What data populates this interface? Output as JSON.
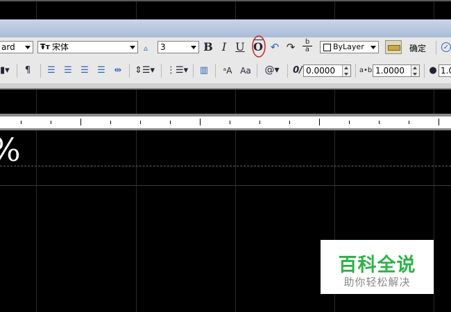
{
  "toolbar1": {
    "style_value": "ard",
    "font_icon": "Ŧт",
    "font_value": "宋体",
    "height_value": "3",
    "bold_label": "B",
    "italic_label": "I",
    "underline_label": "U",
    "overline_label": "O",
    "undo_icon": "↶",
    "redo_icon": "↷",
    "stack_icon_top": "b",
    "stack_icon_bottom": "a",
    "color_value": "ByLayer",
    "ok_label": "确定"
  },
  "toolbar2": {
    "oblique_value": "0.0000",
    "tracking_prefix": "a•b",
    "tracking_value": "1.0000",
    "width_value": "1.0",
    "symbol_icon": "@"
  },
  "canvas": {
    "text_fragment": "%"
  },
  "watermark": {
    "title": "百科全说",
    "subtitle": "助你轻松解决"
  },
  "colors": {
    "titlebar": "#b8c8de",
    "toolbar_bg": "#e8e8e8",
    "highlight_circle": "#d02020",
    "watermark_green": "#2db34a"
  }
}
